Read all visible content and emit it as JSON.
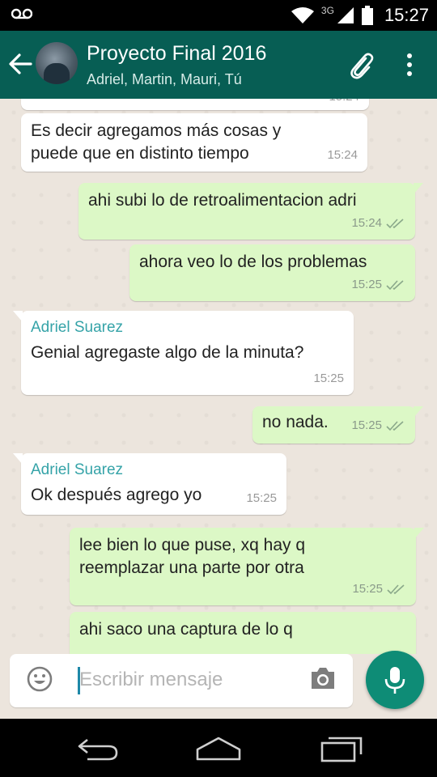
{
  "status": {
    "network": "3G",
    "time": "15:27"
  },
  "header": {
    "title": "Proyecto Final 2016",
    "subtitle": "Adriel, Martin, Mauri, Tú"
  },
  "messages": [
    {
      "dir": "in",
      "sender": "",
      "text": "Es decir agregamos más cosas y puede que en distinto tiempo",
      "time": "15:24"
    },
    {
      "dir": "out",
      "text": "ahi subi lo de retroalimentacion adri",
      "time": "15:24"
    },
    {
      "dir": "out",
      "text": "ahora veo lo de los problemas",
      "time": "15:25"
    },
    {
      "dir": "in",
      "sender": "Adriel Suarez",
      "text": "Genial agregaste algo de la minuta?",
      "time": "15:25"
    },
    {
      "dir": "out",
      "text": "no nada.",
      "time": "15:25"
    },
    {
      "dir": "in",
      "sender": "Adriel Suarez",
      "text": "Ok después agrego yo",
      "time": "15:25"
    },
    {
      "dir": "out",
      "text": "lee bien lo que puse, xq hay q reemplazar una parte por otra",
      "time": "15:25"
    },
    {
      "dir": "out",
      "text": "ahi saco una captura de lo q",
      "time": ""
    }
  ],
  "partial_top_time": "15:24",
  "input": {
    "placeholder": "Escribir mensaje"
  },
  "colors": {
    "header": "#075e54",
    "out_bubble": "#dcf8c6",
    "sender_name": "#35a3a8",
    "mic_button": "#0e8c76"
  },
  "icons": [
    "voicemail-icon",
    "wifi-icon",
    "signal-icon",
    "battery-icon",
    "back-arrow-icon",
    "paperclip-icon",
    "overflow-menu-icon",
    "emoji-icon",
    "camera-icon",
    "mic-icon",
    "nav-back-icon",
    "nav-home-icon",
    "nav-recents-icon",
    "double-check-icon"
  ]
}
